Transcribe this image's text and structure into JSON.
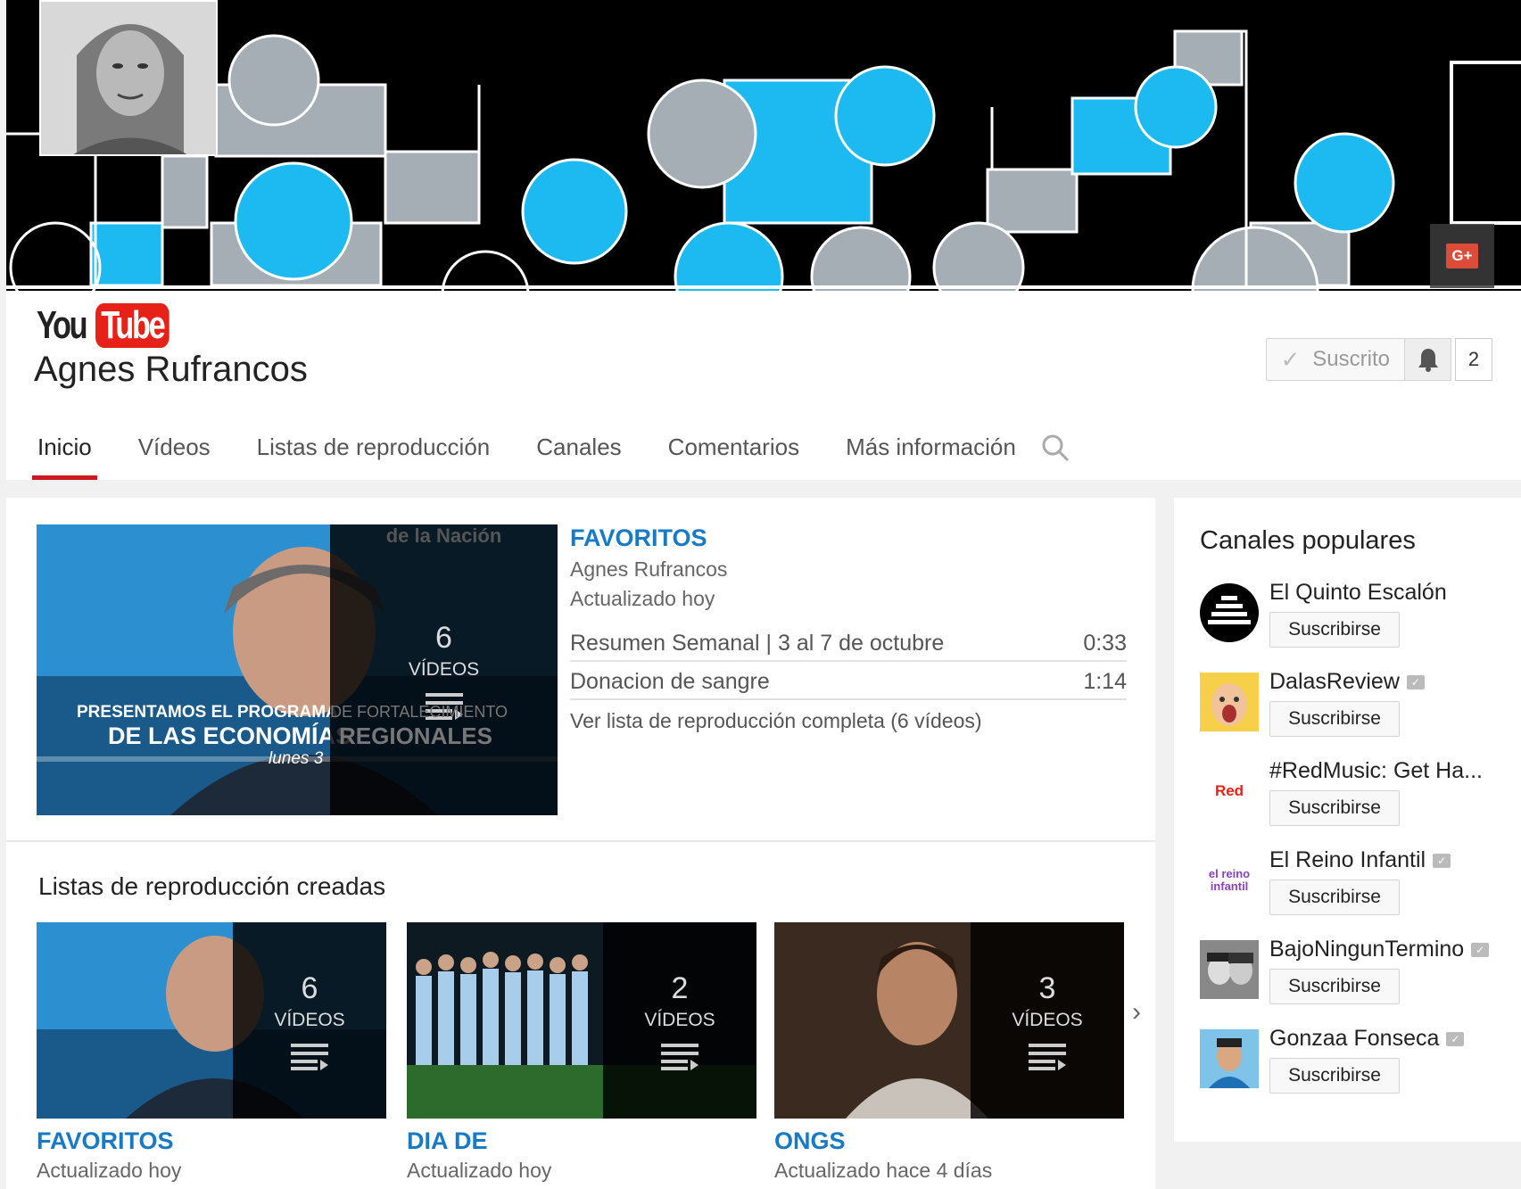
{
  "channel": {
    "logo_you": "You",
    "logo_tube": "Tube",
    "name": "Agnes Rufrancos",
    "subscribed_label": "Suscrito",
    "subscriber_count": "2",
    "gplus_label": "G+"
  },
  "tabs": [
    {
      "label": "Inicio",
      "active": true
    },
    {
      "label": "Vídeos"
    },
    {
      "label": "Listas de reproducción"
    },
    {
      "label": "Canales"
    },
    {
      "label": "Comentarios"
    },
    {
      "label": "Más información"
    }
  ],
  "featured": {
    "title": "FAVORITOS",
    "owner": "Agnes Rufrancos",
    "updated": "Actualizado hoy",
    "video_count": "6",
    "video_unit": "VÍDEOS",
    "thumb_caption_line1": "PRESENTAMOS EL PROGRAMA",
    "thumb_caption_line2": "DE LAS ECONOMÍAS",
    "thumb_caption_line3": "lunes 3",
    "thumb_faded_1": "DE FORTALECIMIENTO",
    "thumb_faded_2": "REGIONALES",
    "thumb_watermark": "de la Nación",
    "videos": [
      {
        "title": "Resumen Semanal | 3 al 7 de octubre",
        "duration": "0:33"
      },
      {
        "title": "Donacion de sangre",
        "duration": "1:14"
      }
    ],
    "view_full": "Ver lista de reproducción completa (6 vídeos)"
  },
  "created": {
    "title": "Listas de reproducción creadas",
    "playlists": [
      {
        "title": "FAVORITOS",
        "updated": "Actualizado hoy",
        "count": "6",
        "unit": "VÍDEOS"
      },
      {
        "title": "DIA DE",
        "updated": "Actualizado hoy",
        "count": "2",
        "unit": "VÍDEOS"
      },
      {
        "title": "ONGS",
        "updated": "Actualizado hace 4 días",
        "count": "3",
        "unit": "VÍDEOS"
      }
    ]
  },
  "popular": {
    "title": "Canales populares",
    "subscribe_label": "Suscribirse",
    "channels": [
      {
        "name": "El Quinto Escalón",
        "verified": false
      },
      {
        "name": "DalasReview",
        "verified": true
      },
      {
        "name": "#RedMusic: Get Ha...",
        "verified": false,
        "avatar_text": "Red"
      },
      {
        "name": "El Reino Infantil",
        "verified": true,
        "avatar_text": "el reino infantil"
      },
      {
        "name": "BajoNingunTermino",
        "verified": true
      },
      {
        "name": "Gonzaa Fonseca",
        "verified": true
      }
    ]
  },
  "colors": {
    "accent_red": "#cc181e",
    "link_blue": "#167ac6",
    "banner_cyan": "#1cbaf0",
    "banner_gray": "#a5adb5"
  }
}
